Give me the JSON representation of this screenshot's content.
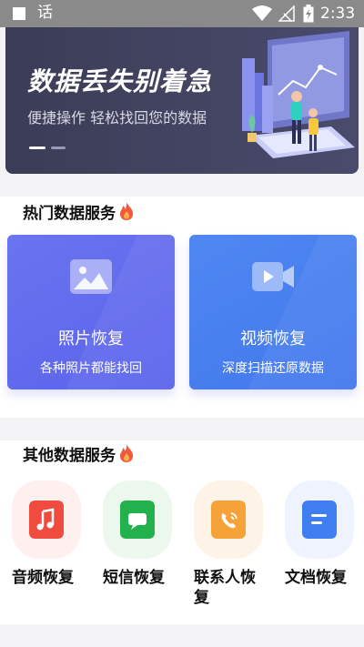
{
  "status_bar": {
    "app_glyph": "话",
    "time": "2:33"
  },
  "banner": {
    "title": "数据丢失别着急",
    "subtitle": "便捷操作 轻松找回您的数据"
  },
  "hot_section": {
    "title": "热门数据服务",
    "cards": [
      {
        "title": "照片恢复",
        "subtitle": "各种照片都能找回",
        "icon": "image-icon"
      },
      {
        "title": "视频恢复",
        "subtitle": "深度扫描还原数据",
        "icon": "video-icon"
      }
    ]
  },
  "other_section": {
    "title": "其他数据服务",
    "tools": [
      {
        "label": "音频恢复",
        "icon": "music-icon",
        "color": "#ef4b3f",
        "bubble": "#fdf0ee"
      },
      {
        "label": "短信恢复",
        "icon": "message-icon",
        "color": "#22b14c",
        "bubble": "#ecf8ee"
      },
      {
        "label": "联系人恢复",
        "icon": "phone-contact-icon",
        "color": "#f5a238",
        "bubble": "#fdf3e6"
      },
      {
        "label": "文档恢复",
        "icon": "document-icon",
        "color": "#3f7ef0",
        "bubble": "#eef3fd"
      }
    ]
  }
}
